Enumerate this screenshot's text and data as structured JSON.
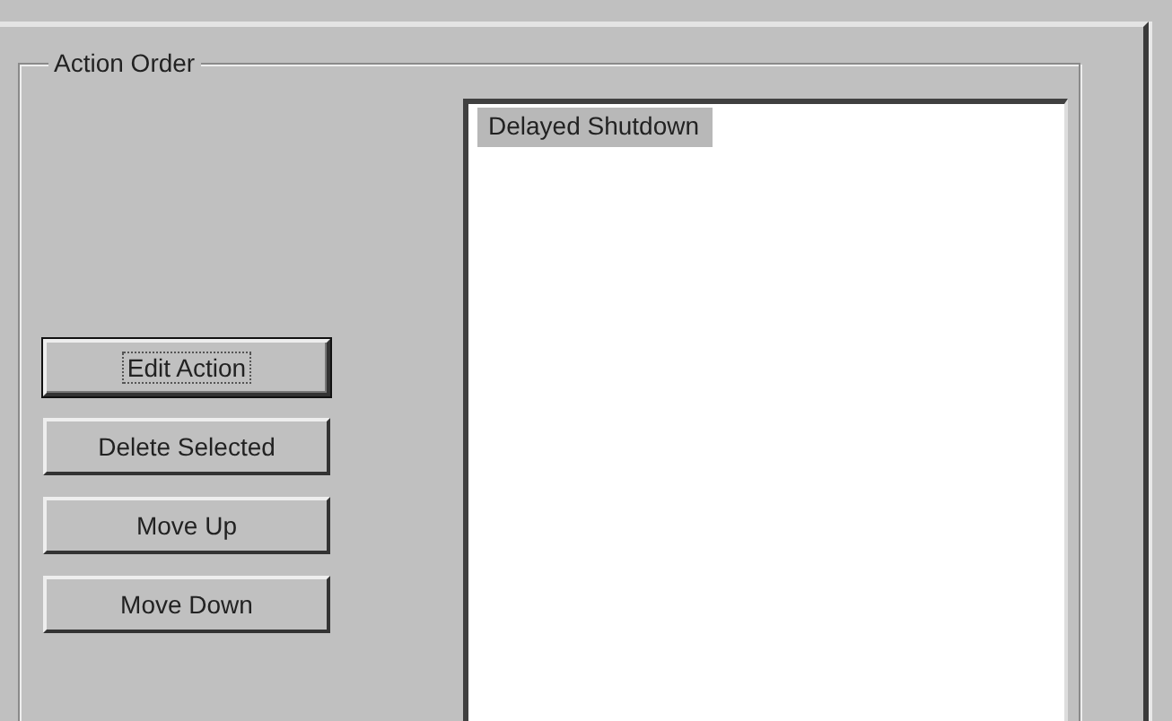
{
  "group": {
    "title": "Action Order"
  },
  "buttons": [
    {
      "label": "Edit Action",
      "default": true
    },
    {
      "label": "Delete Selected",
      "default": false
    },
    {
      "label": "Move Up",
      "default": false
    },
    {
      "label": "Move Down",
      "default": false
    }
  ],
  "list": {
    "items": [
      {
        "label": "Delayed Shutdown",
        "selected": true
      }
    ]
  }
}
